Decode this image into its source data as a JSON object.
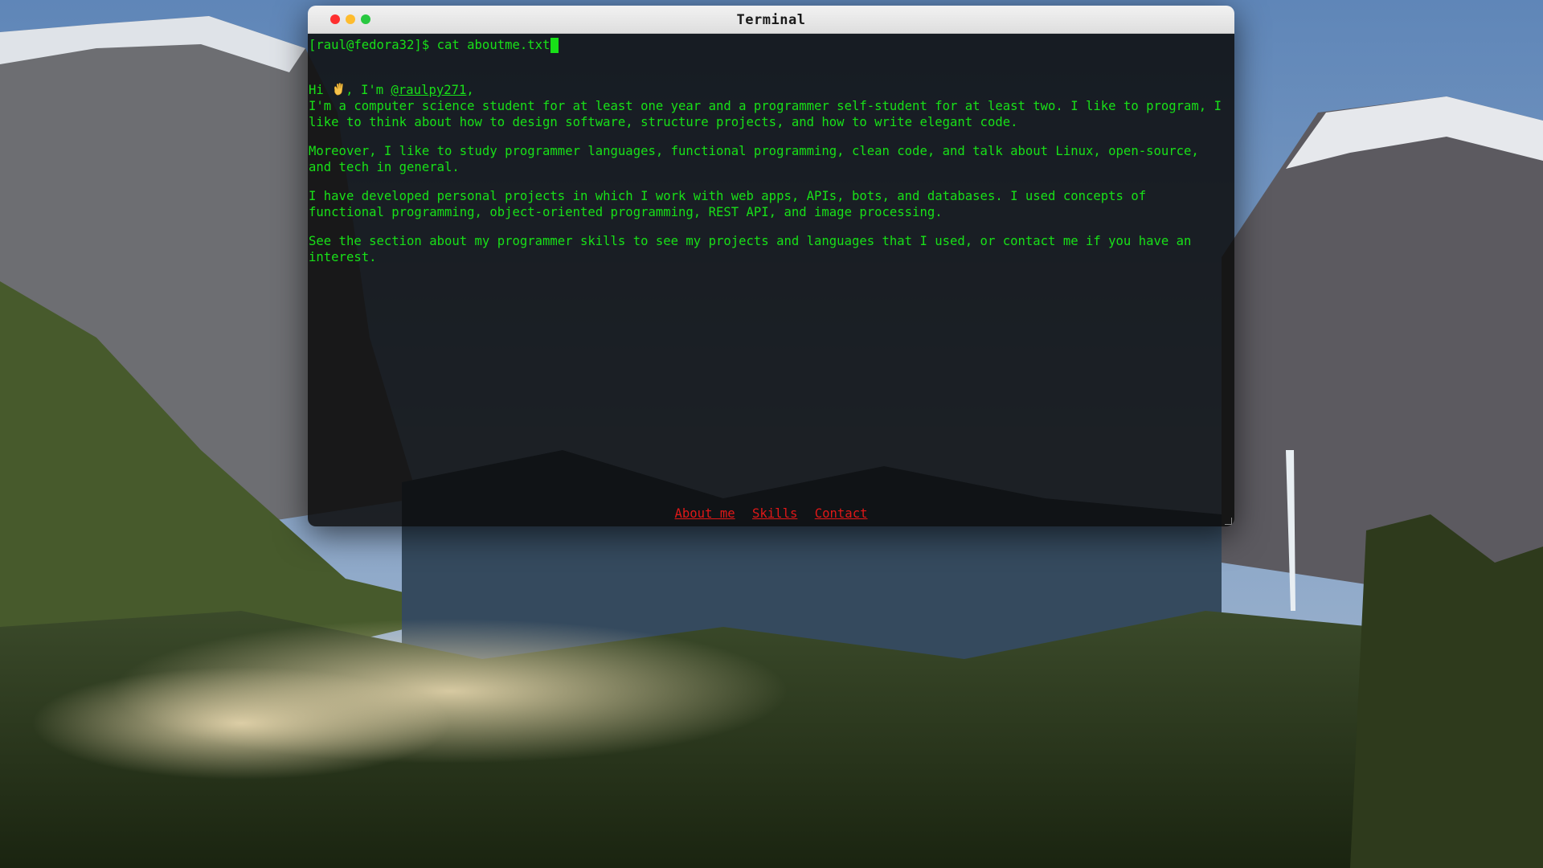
{
  "window": {
    "title": "Terminal"
  },
  "terminal": {
    "prompt": "[raul@fedora32]$ cat aboutme.txt",
    "greeting_prefix": "Hi ",
    "greeting_mid": ", I'm ",
    "handle": "@raulpy271",
    "greeting_suffix": ",",
    "paragraphs": [
      "I'm a computer science student for at least one year and a programmer self-student for at least two. I like to program, I like to think about how to design software, structure projects, and how to write elegant code.",
      "Moreover, I like to study programmer languages, functional programming, clean code, and talk about Linux, open-source, and tech in general.",
      "I have developed personal projects in which I work with web apps, APIs, bots, and databases. I used concepts of functional programming, object-oriented programming, REST API, and image processing.",
      "See the section about my programmer skills to see my projects and languages that I used, or contact me if you have an interest."
    ]
  },
  "nav": {
    "about": "About me",
    "skills": "Skills",
    "contact": "Contact"
  },
  "colors": {
    "terminal_text": "#18e018",
    "nav_link": "#e01818",
    "close": "#fe2f2f",
    "minimize": "#febc2e",
    "maximize": "#28c840"
  },
  "icons": {
    "wave": "waving-hand-icon"
  }
}
